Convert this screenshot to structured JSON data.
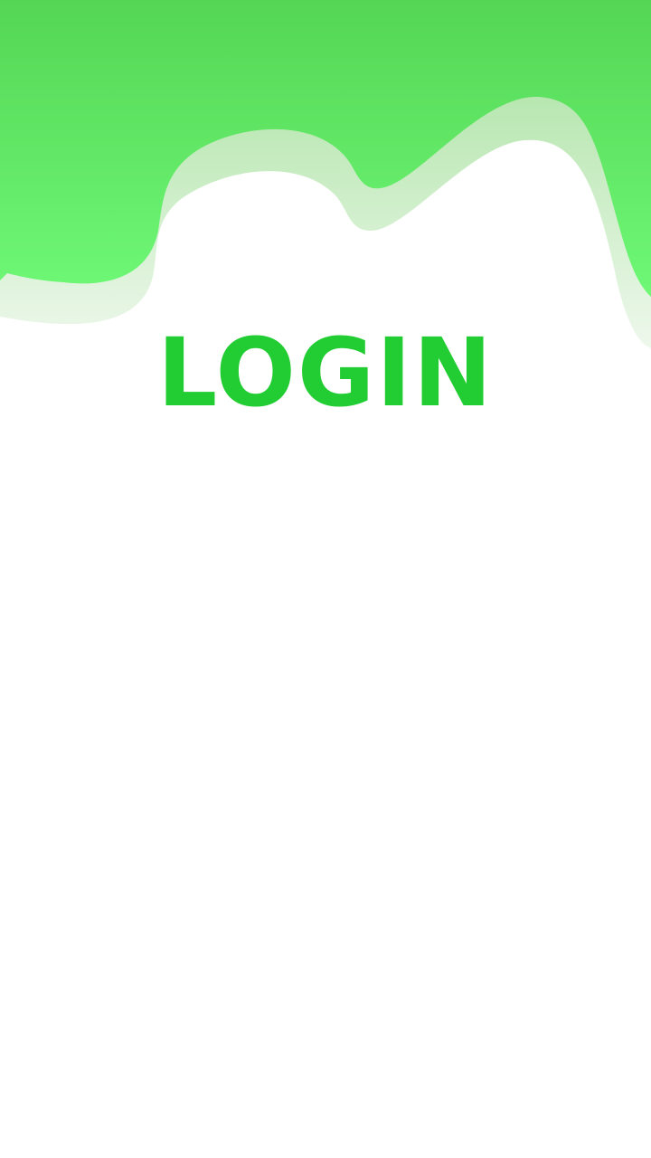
{
  "screen": {
    "title": "LOGIN"
  },
  "colors": {
    "title": "#22cc33",
    "wave_top": "#55d655",
    "wave_bottom": "#6ef876",
    "wave_shadow": "#bfe9b8",
    "background": "#ffffff"
  }
}
